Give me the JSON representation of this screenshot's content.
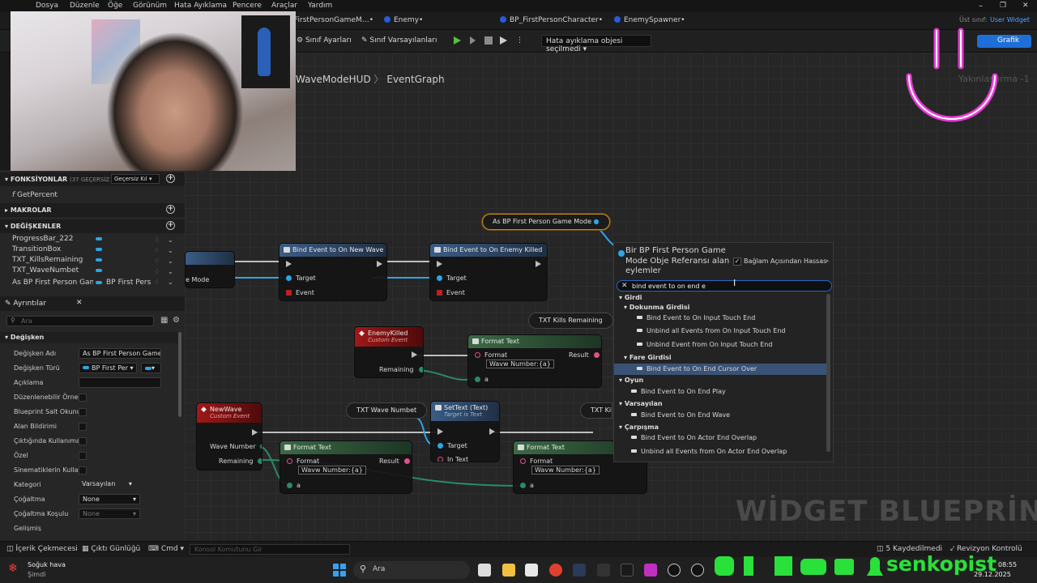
{
  "menu": [
    "Dosya",
    "Düzenle",
    "Öğe",
    "Görünüm",
    "Hata Ayıklama",
    "Pencere",
    "Araçlar",
    "Yardım"
  ],
  "tabs": [
    "FirstPersonGameM…•",
    "Enemy•",
    "BP_FirstPersonCharacter•",
    "EnemySpawner•"
  ],
  "parent_class": {
    "label": "Üst sınıf:",
    "value": "User Widget"
  },
  "toolbar": {
    "class_settings": "Sınıf Ayarları",
    "class_defaults": "Sınıf Varsayılanları",
    "debug_select": "Hata ayıklama objesi seçilmedi",
    "graph_button": "Grafik"
  },
  "breadcrumb": {
    "part1": "WaveModeHUD",
    "sep": "〉",
    "part2": "EventGraph"
  },
  "graph_corner": "Yakınlaştırma -1",
  "functions": {
    "header": "FONKSİYONLAR",
    "override_note": "(37 GEÇERSİZ KILIN",
    "override_btn": "Geçersiz Kıl",
    "items": [
      "GetPercent"
    ]
  },
  "macros_header": "MAKROLAR",
  "variables": {
    "header": "DEĞİŞKENLER",
    "items": [
      "ProgressBar_222",
      "TransitionBox",
      "TXT_KillsRemaining",
      "TXT_WaveNumbet",
      "As BP First Person Game I"
    ],
    "last_type": "BP First Perso"
  },
  "details": {
    "tab": "Ayrıntılar",
    "search_placeholder": "Ara",
    "section": "Değişken",
    "rows": {
      "name_label": "Değişken Adı",
      "name_value": "As BP First Person Game I",
      "type_label": "Değişken Türü",
      "type_value": "BP First Per",
      "desc_label": "Açıklama",
      "editable_label": "Düzenlenebilir Örnek",
      "readonly_label": "Blueprint Salt Okunur",
      "expose_label": "Alan Bildirimi",
      "spawn_label": "Çıktığında Kullanıma",
      "private_label": "Özel",
      "cinematic_label": "Sinematiklerin Kullan",
      "category_label": "Kategori",
      "category_value": "Varsayılan",
      "replication_label": "Çoğaltma",
      "replication_value": "None",
      "repcond_label": "Çoğaltma Koşulu",
      "repcond_value": "None",
      "more_label": "Gelişmiş"
    }
  },
  "nodes": {
    "cast": "As BP First Person Game Mode",
    "bind_wave": "Bind Event to On New Wave",
    "bind_killed": "Bind Event to On Enemy Killed",
    "target": "Target",
    "event": "Event",
    "game_mode_pin": "e Mode",
    "txt_kills": "TXT Kills Remaining",
    "enemy_killed": "EnemyKilled",
    "custom_event": "Custom Event",
    "remaining": "Remaining",
    "format_text": "Format Text",
    "format": "Format",
    "result": "Result",
    "format_value": "Wavw Number:{a}",
    "a": "a",
    "txt_wave": "TXT Wave Numbet",
    "settext": "SetText (Text)",
    "target_is_text": "Target is Text",
    "in_text": "In Text",
    "new_wave": "NewWave",
    "wave_number": "Wave Number",
    "txt_kills_partial": "TXT Kill"
  },
  "popup": {
    "title": "Bir BP First Person Game Mode Obje Referansı alan eylemler",
    "context_sensitive": "Bağlam Açısından Hassas",
    "search_value": "bind event to on end e",
    "categories": {
      "input": "Girdi",
      "touch": "Dokunma Girdisi",
      "mouse": "Fare Girdisi",
      "game": "Oyun",
      "default": "Varsayılan",
      "collision": "Çarpışma"
    },
    "results": [
      "Bind Event to On Input Touch End",
      "Unbind all Events from On Input Touch End",
      "Unbind Event from On Input Touch End",
      "Bind Event to On End Cursor Over",
      "Bind Event to On End Play",
      "Bind Event to On End Wave",
      "Bind Event to On Actor End Overlap",
      "Unbind all Events from On Actor End Overlap"
    ]
  },
  "watermark": "WİDGET BLUEPRİNT'İ",
  "statusbar": {
    "content_drawer": "İçerik Çekmecesi",
    "output_log": "Çıktı Günlüğü",
    "cmd": "Cmd",
    "console_placeholder": "Konsol Komutunu Gir",
    "saved": "5 Kaydedilmedi",
    "revision": "Revizyon Kontrolü"
  },
  "taskbar": {
    "weather": "Soğuk hava",
    "weather_sub": "Şimdi",
    "search": "Ara",
    "time": "08:55",
    "date": "29.12.2025"
  },
  "overlay_brand": "senkopist",
  "colors": {
    "accent": "#1f6fd8",
    "exec": "#bdbdbd",
    "object_pin": "#2aa7e8",
    "brand_green": "#2ae03a",
    "logo_pink": "#e83ad8"
  }
}
